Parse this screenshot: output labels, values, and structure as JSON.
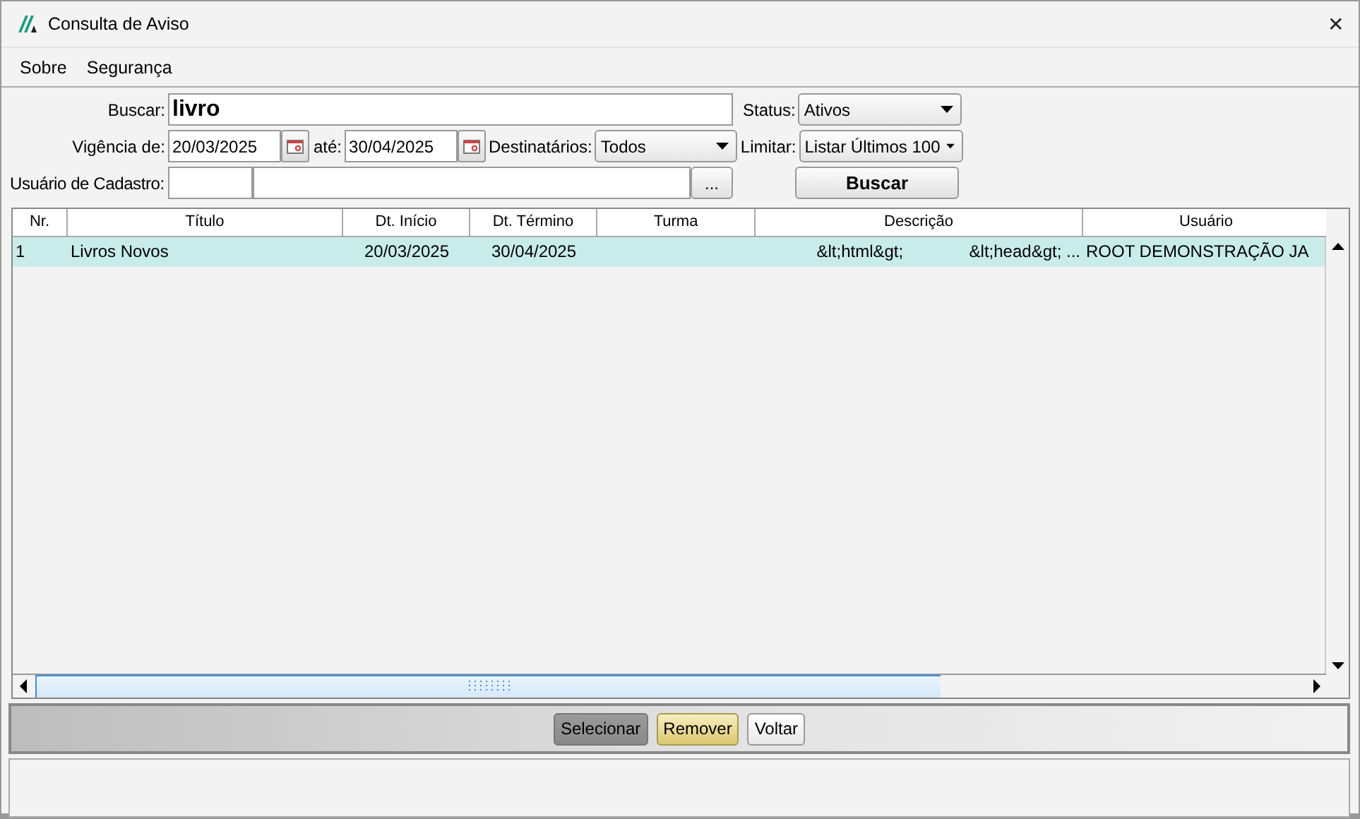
{
  "window": {
    "title": "Consulta de Aviso",
    "close": "✕"
  },
  "menu": [
    {
      "label": "Sobre"
    },
    {
      "label": "Segurança"
    }
  ],
  "search": {
    "label": "Buscar:",
    "value": "livro",
    "status_label": "Status:",
    "status": "Ativos"
  },
  "period": {
    "label": "Vigência de:",
    "from": "20/03/2025",
    "to_label": "até:",
    "to": "30/04/2025",
    "recipients_label": "Destinatários:",
    "recipients": "Todos",
    "limit_label": "Limitar:",
    "limit": "Listar Últimos 100"
  },
  "user": {
    "label": "Usuário de Cadastro:",
    "browse": "...",
    "search_button": "Buscar"
  },
  "table": {
    "columns": [
      "Nr.",
      "Título",
      "Dt. Início",
      "Dt. Término",
      "Turma",
      "Descrição",
      "Usuário"
    ],
    "rows": [
      {
        "selected": true,
        "cells": [
          "1",
          "Livros Novos",
          "20/03/2025",
          "30/04/2025",
          "",
          "&lt;html&gt;              &lt;head&gt; ...",
          "ROOT DEMONSTRAÇÃO JA"
        ]
      }
    ]
  },
  "buttons": [
    {
      "label": "Selecionar",
      "kind": "pressed"
    },
    {
      "label": "Remover",
      "kind": "highlight"
    },
    {
      "label": "Voltar",
      "kind": "normal"
    }
  ]
}
